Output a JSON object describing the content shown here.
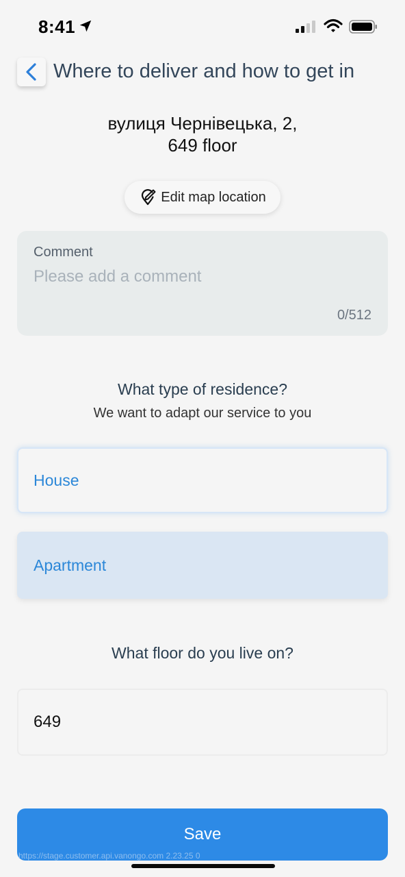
{
  "status_bar": {
    "time": "8:41",
    "icons": [
      "location-arrow-icon",
      "signal-icon",
      "wifi-icon",
      "battery-icon"
    ]
  },
  "header": {
    "back_icon": "chevron-left-icon",
    "title": "Where to deliver and how to get in"
  },
  "address": {
    "line1": "вулиця Чернівецька, 2,",
    "line2": "649 floor"
  },
  "edit_map": {
    "icon": "map-pin-edit-icon",
    "label": "Edit map location"
  },
  "comment": {
    "label": "Comment",
    "placeholder": "Please add a comment",
    "value": "",
    "counter": "0/512"
  },
  "residence": {
    "question": "What type of residence?",
    "subtitle": "We want to adapt our service to you",
    "options": [
      {
        "label": "House",
        "selected": false
      },
      {
        "label": "Apartment",
        "selected": true
      }
    ]
  },
  "floor": {
    "question": "What floor do you live on?",
    "value": "649"
  },
  "save": {
    "label": "Save"
  },
  "debug_url": "https://stage.customer.api.vanongo.com  2.23.25  0",
  "colors": {
    "accent": "#2d8ae6",
    "option_text": "#2b87d8",
    "selected_option_bg": "#dae6f3",
    "comment_bg": "#e8ecec",
    "page_bg": "#f5f5f5"
  }
}
